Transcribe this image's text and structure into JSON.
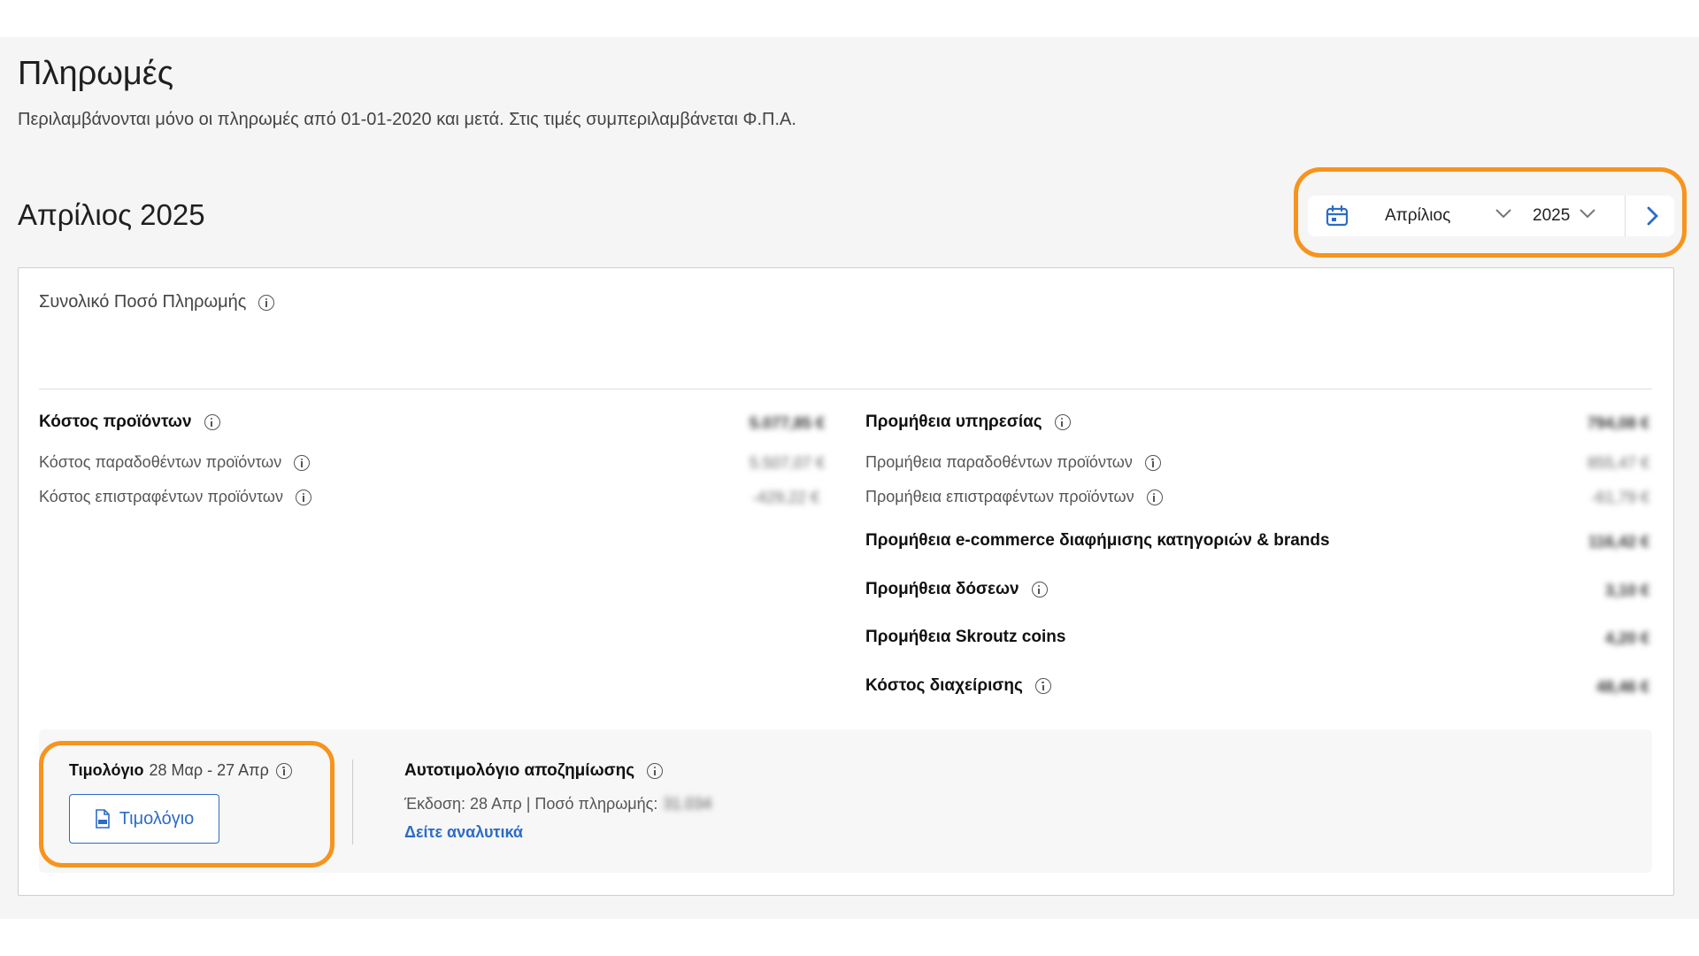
{
  "page": {
    "title": "Πληρωμές",
    "subtitle": "Περιλαμβάνονται μόνο οι πληρωμές από 01-01-2020 και μετά. Στις τιμές συμπεριλαμβάνεται Φ.Π.Α.",
    "period_title": "Απρίλιος 2025"
  },
  "picker": {
    "icon": "calendar-icon",
    "month": "Απρίλιος",
    "year": "2025",
    "next_icon": "chevron-right-icon"
  },
  "summary": {
    "total_label": "Συνολικό Ποσό Πληρωμής"
  },
  "left_column": {
    "header": {
      "label": "Κόστος προϊόντων",
      "amount": "5.077,85 €"
    },
    "rows": [
      {
        "label": "Κόστος παραδοθέντων προϊόντων",
        "amount": "5.507,07 €"
      },
      {
        "label": "Κόστος επιστραφέντων προϊόντων",
        "amount": "-429,22 €"
      }
    ]
  },
  "right_column": {
    "header": {
      "label": "Προμήθεια υπηρεσίας",
      "amount": "794,08 €"
    },
    "rows": [
      {
        "label": "Προμήθεια παραδοθέντων προϊόντων",
        "amount": "855,47 €"
      },
      {
        "label": "Προμήθεια επιστραφέντων προϊόντων",
        "amount": "-61,79 €"
      }
    ],
    "bold_rows": [
      {
        "label": "Προμήθεια e-commerce διαφήμισης κατηγοριών & brands",
        "amount": "116,42 €"
      },
      {
        "label": "Προμήθεια δόσεων",
        "amount": "3,10 €"
      },
      {
        "label": "Προμήθεια Skroutz coins",
        "amount": "4,20 €"
      },
      {
        "label": "Κόστος διαχείρισης",
        "amount": "48,46 €"
      }
    ]
  },
  "invoice": {
    "label": "Τιμολόγιο",
    "range": "28 Μαρ - 27 Απρ",
    "button_label": "Τιμολόγιο"
  },
  "self_invoice": {
    "label": "Αυτοτιμολόγιο αποζημίωσης",
    "issue_text": "Έκδοση: 28 Απρ | Ποσό πληρωμής:",
    "issue_amount": "31.034",
    "details_link": "Δείτε αναλυτικά"
  },
  "colors": {
    "accent": "#2d6cc6",
    "highlight": "#f7941d"
  }
}
